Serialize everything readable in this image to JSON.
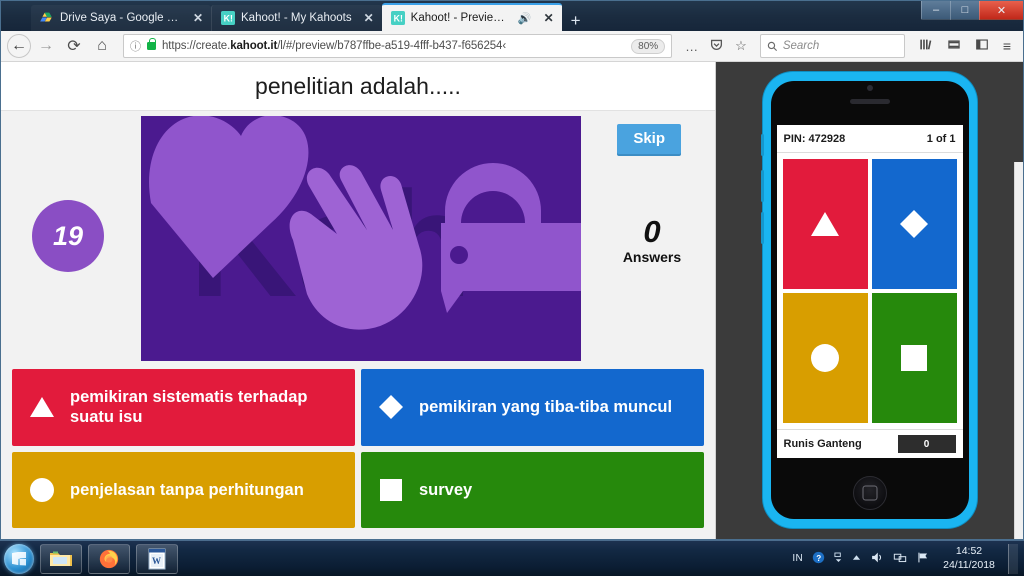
{
  "window": {
    "controls": {
      "minimize": "–",
      "maximize": "□",
      "close": "✕"
    }
  },
  "tabs": [
    {
      "title": "Drive Saya - Google Drive",
      "favicon": "google-drive-icon",
      "close": "✕",
      "active": false
    },
    {
      "title": "Kahoot! - My Kahoots",
      "favicon": "kahoot-icon",
      "close": "✕",
      "active": false
    },
    {
      "title": "Kahoot! - Preview kahoot!",
      "favicon": "kahoot-icon",
      "close": "✕",
      "active": true,
      "audio": "🔊"
    }
  ],
  "newtab_label": "+",
  "navbar": {
    "back": "←",
    "forward": "→",
    "reload": "⟳",
    "home": "⌂",
    "info": "ⓘ",
    "url_prefix": "https://create.",
    "url_domain": "kahoot.it",
    "url_suffix": "/l/#/preview/b787ffbe-a519-4fff-b437-f656254‹",
    "zoom_level": "80%",
    "page_actions": "…",
    "pocket": "✔",
    "bookmark": "☆",
    "search_placeholder": "Search",
    "search_value": "",
    "library": "library-icon",
    "screenshot": "screenshot-icon",
    "sidebar": "sidebar-icon",
    "menu": "≡"
  },
  "quiz": {
    "question": "penelitian adalah.....",
    "timer": "19",
    "skip_label": "Skip",
    "answers_count": "0",
    "answers_label": "Answers",
    "banner_alt": "kahoot-purple-banner",
    "options": [
      {
        "shape": "triangle",
        "text": "pemikiran sistematis terhadap suatu isu",
        "color": "#e21b3c"
      },
      {
        "shape": "diamond",
        "text": "pemikiran yang tiba-tiba muncul",
        "color": "#1368ce"
      },
      {
        "shape": "circle",
        "text": "penjelasan tanpa perhitungan",
        "color": "#d89e00"
      },
      {
        "shape": "square",
        "text": "survey",
        "color": "#26890c"
      }
    ]
  },
  "phone": {
    "pin_label": "PIN: 472928",
    "progress": "1 of 1",
    "nickname": "Runis Ganteng",
    "score": "0",
    "tiles": [
      {
        "shape": "triangle",
        "color": "#e21b3c"
      },
      {
        "shape": "diamond",
        "color": "#1368ce"
      },
      {
        "shape": "circle",
        "color": "#d89e00"
      },
      {
        "shape": "square",
        "color": "#26890c"
      }
    ]
  },
  "taskbar": {
    "start": "start-orb",
    "items": [
      {
        "name": "windows-explorer-icon"
      },
      {
        "name": "firefox-icon"
      },
      {
        "name": "word-icon"
      }
    ],
    "tray": {
      "language": "IN",
      "help": "?",
      "triangle": "▲",
      "volume": "🔊",
      "network": "network-icon",
      "flag": "flag-icon"
    },
    "time": "14:52",
    "date": "24/11/2018"
  }
}
